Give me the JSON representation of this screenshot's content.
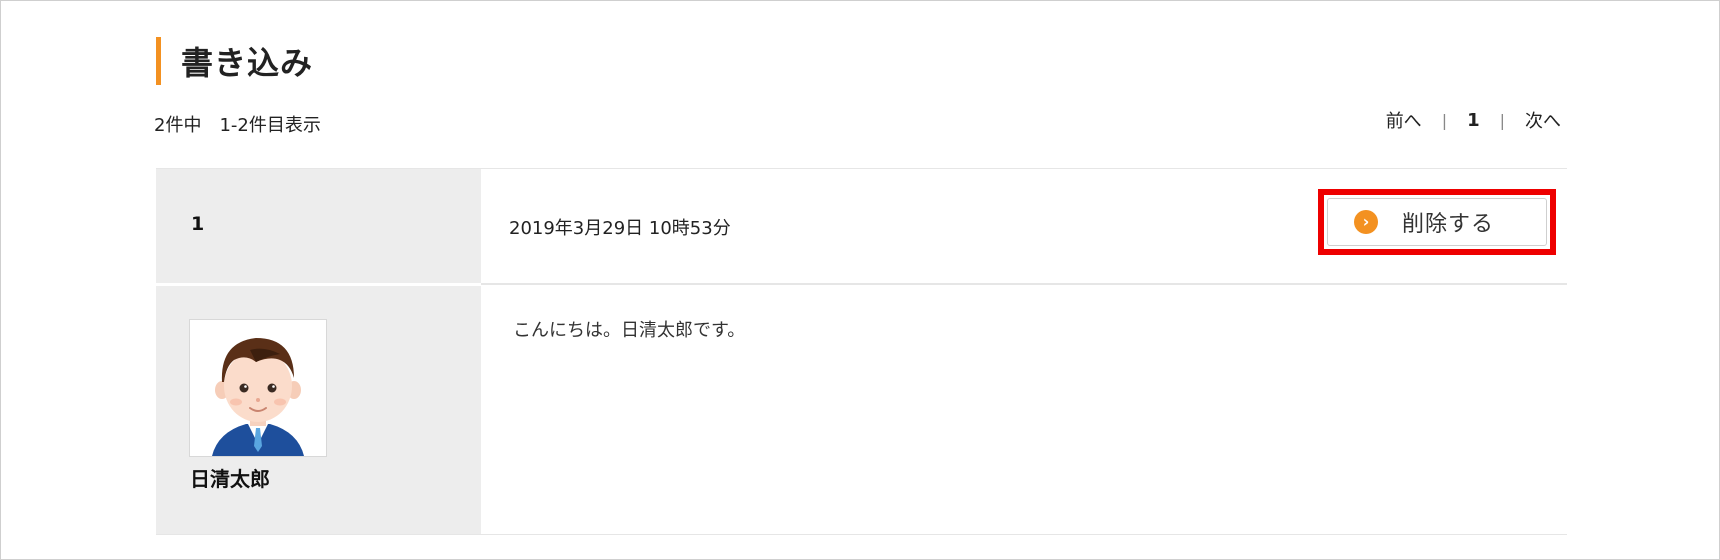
{
  "page": {
    "title": "書き込み"
  },
  "summary": {
    "count_text": "2件中　1-2件目表示"
  },
  "pager": {
    "prev_label": "前へ",
    "separator": "|",
    "current_page": "1",
    "next_label": "次へ"
  },
  "post": {
    "number": "1",
    "datetime": "2019年3月29日 10時53分",
    "delete_label": "削除する",
    "delete_icon": "chevron-right-circle-icon",
    "author": "日清太郎",
    "message": "こんにちは。日清太郎です。",
    "avatar_icon": "businessman-avatar"
  },
  "colors": {
    "accent": "#f39121",
    "highlight": "#ee0000",
    "panel_bg": "#ededed"
  }
}
